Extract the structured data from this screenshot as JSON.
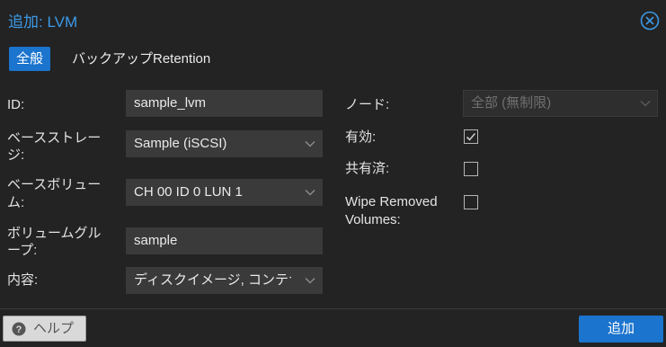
{
  "dialog": {
    "title": "追加: LVM"
  },
  "tabs": [
    {
      "label": "全般",
      "active": true
    },
    {
      "label": "バックアップRetention",
      "active": false
    }
  ],
  "left_fields": {
    "id": {
      "label": "ID:",
      "value": "sample_lvm"
    },
    "base_storage": {
      "label_line1": "ベースストレー",
      "label_line2": "ジ:",
      "value": "Sample (iSCSI)"
    },
    "base_volume": {
      "label_line1": "ベースボリュー",
      "label_line2": "ム:",
      "value": "CH 00 ID 0 LUN 1"
    },
    "volume_group": {
      "label_line1": "ボリュームグル",
      "label_line2": "ープ:",
      "value": "sample"
    },
    "content": {
      "label": "内容:",
      "value": "ディスクイメージ, コンテナ"
    }
  },
  "right_fields": {
    "node": {
      "label": "ノード:",
      "value": "全部 (無制限)"
    },
    "enabled": {
      "label": "有効:",
      "checked": true
    },
    "shared": {
      "label": "共有済:",
      "checked": false
    },
    "wipe_removed": {
      "label_line1": "Wipe Removed",
      "label_line2": "Volumes:",
      "checked": false
    }
  },
  "footer": {
    "help_label": "ヘルプ",
    "add_label": "追加"
  },
  "colors": {
    "accent": "#1b74cd",
    "title": "#3c9ae8",
    "background": "#232323",
    "field": "#3a3a3a"
  }
}
